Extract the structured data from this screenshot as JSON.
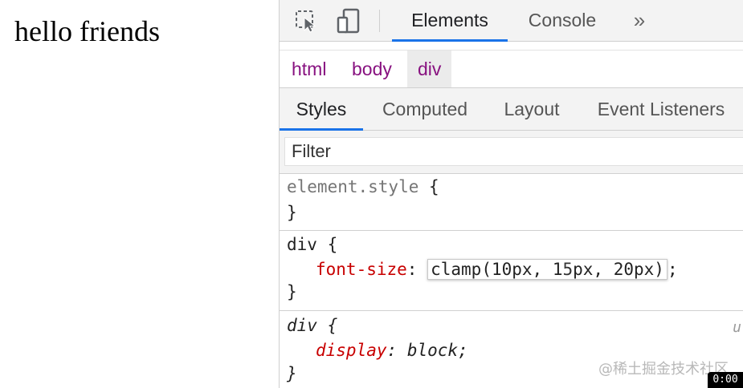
{
  "page": {
    "text": "hello friends"
  },
  "devtools": {
    "toolbar": {
      "tabs": {
        "elements": "Elements",
        "console": "Console"
      },
      "more_glyph": "»",
      "icons": [
        "inspect-element-icon",
        "device-toggle-icon"
      ]
    },
    "breadcrumbs": [
      "html",
      "body",
      "div"
    ],
    "sidebar_tabs": [
      "Styles",
      "Computed",
      "Layout",
      "Event Listeners"
    ],
    "filter": {
      "placeholder": "Filter"
    },
    "rules": {
      "element_style": {
        "selector": "element.style",
        "open": "{",
        "close": "}"
      },
      "div_author": {
        "selector": "div",
        "open": "{",
        "property": "font-size",
        "colon": ":",
        "value_prefix": "clamp(10px, 1",
        "value_suffix": "px, 20px)",
        "semicolon": ";",
        "close": "}"
      },
      "div_ua": {
        "selector": "div",
        "open": "{",
        "property": "display",
        "colon": ":",
        "value": "block",
        "semicolon": ";",
        "close": "}",
        "source_mark": "u"
      }
    },
    "accent_color": "#1a73e8",
    "tag_color": "#881280",
    "property_color": "#c80000"
  },
  "overlay": {
    "watermark": "@稀土掘金技术社区",
    "timestamp": "0:00"
  }
}
